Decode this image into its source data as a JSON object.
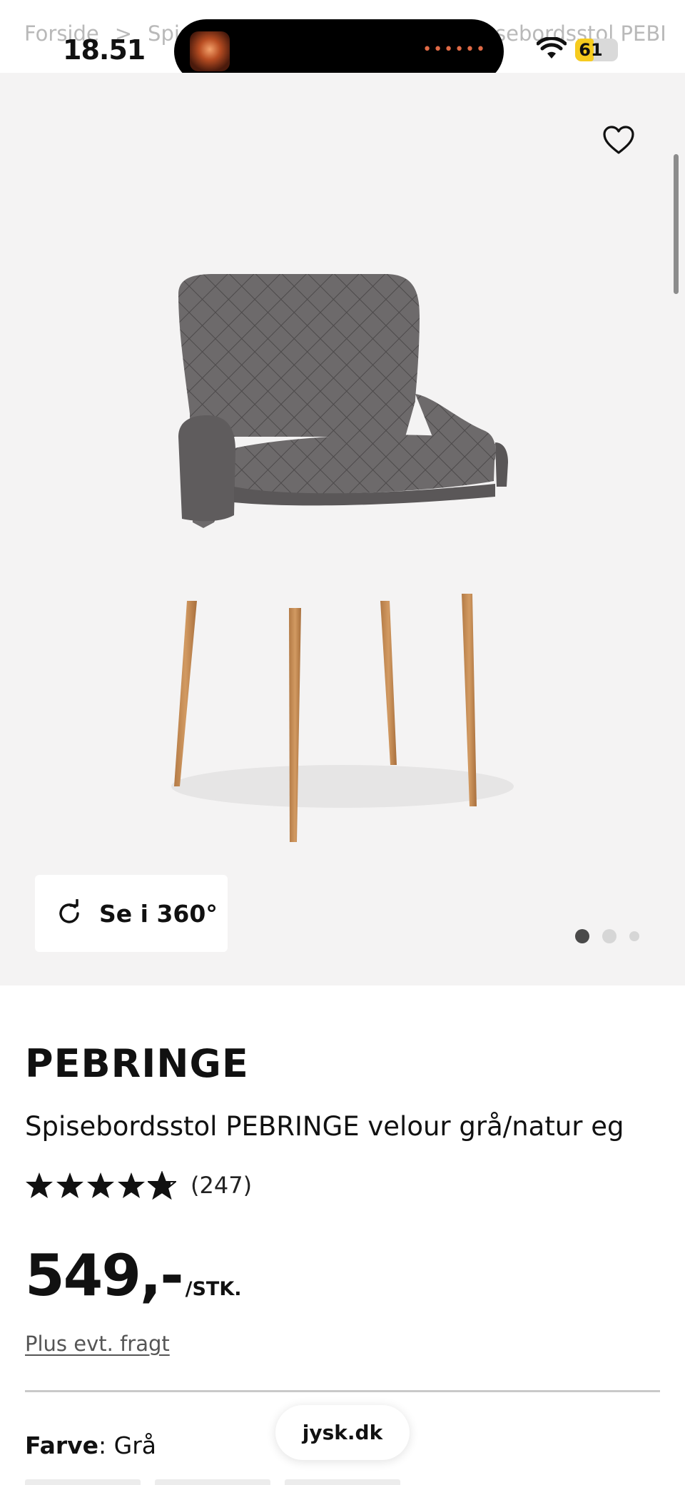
{
  "status_bar": {
    "time": "18.51",
    "battery_level": 61,
    "battery_text": "61"
  },
  "breadcrumb": {
    "items": [
      "Forside",
      "Spis"
    ],
    "trailing": "sebordsstol PEBI",
    "separator": ">"
  },
  "gallery": {
    "favorite_icon": "heart-outline-icon",
    "view_360_label": "Se i 360°",
    "view_360_icon": "rotate-icon",
    "dots_total": 3,
    "active_dot": 1
  },
  "product": {
    "brand": "PEBRINGE",
    "title": "Spisebordsstol PEBRINGE velour grå/natur eg",
    "rating": 4.8,
    "review_count": "(247)",
    "price": "549,-",
    "price_unit": "/STK.",
    "freight_link": "Plus evt. fragt",
    "color_label": "Farve",
    "color_value": "Grå"
  },
  "browser": {
    "url": "jysk.dk"
  },
  "colors": {
    "gallery_bg": "#f4f3f3",
    "battery_fill": "#f6cb1e",
    "text": "#111111"
  }
}
